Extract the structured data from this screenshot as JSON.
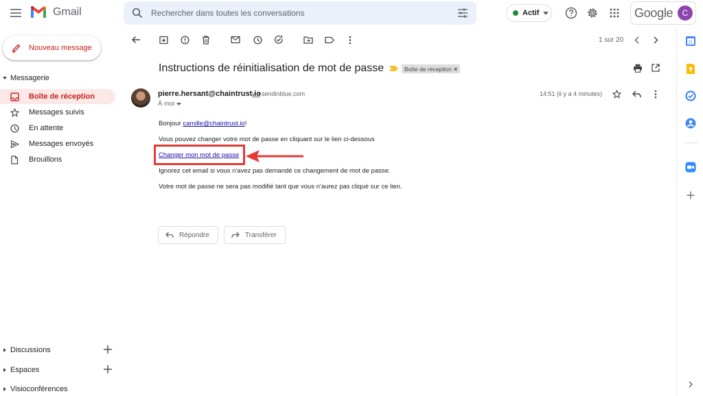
{
  "header": {
    "app_name": "Gmail",
    "search_placeholder": "Rechercher dans toutes les conversations",
    "status_label": "Actif",
    "google_word": "Google",
    "avatar_letter": "C"
  },
  "sidebar": {
    "compose_label": "Nouveau message",
    "section_title": "Messagerie",
    "items": [
      {
        "label": "Boîte de réception",
        "icon": "inbox-icon",
        "active": true
      },
      {
        "label": "Messages suivis",
        "icon": "star-icon",
        "active": false
      },
      {
        "label": "En attente",
        "icon": "clock-icon",
        "active": false
      },
      {
        "label": "Messages envoyés",
        "icon": "send-icon",
        "active": false
      },
      {
        "label": "Brouillons",
        "icon": "draft-icon",
        "active": false
      }
    ],
    "bottom_sections": [
      "Discussions",
      "Espaces",
      "Visioconférences"
    ]
  },
  "toolbar": {
    "pager": "1 sur 20"
  },
  "message": {
    "subject": "Instructions de réinitialisation de mot de passe",
    "label_chip": "Boîte de réception",
    "sender_email": "pierre.hersant@chaintrust.io",
    "via_word": "via",
    "via_domain": "sendinblue.com",
    "to_label": "À moi",
    "timestamp": "14:51 (il y a 4 minutes)",
    "greeting_prefix": "Bonjour ",
    "greeting_email": "camille@chaintrust.io",
    "greeting_suffix": "!",
    "line1": "Vous pouvez changer votre mot de passe en cliquant sur le lien ci-dessous",
    "link_text": "Changer mon mot de passe",
    "line2": "Ignorez cet email si vous n'avez pas demandé ce changement de mot de passe.",
    "line3": "Votre mot de passe ne sera pas modifié tant que vous n'aurez pas cliqué sur ce lien."
  },
  "actions": {
    "reply_label": "Répondre",
    "forward_label": "Transférer"
  },
  "colors": {
    "accent_red": "#c5221f",
    "active_bg": "#fce8e6",
    "annotation_red": "#e53935",
    "link_blue": "#1a0dab"
  }
}
